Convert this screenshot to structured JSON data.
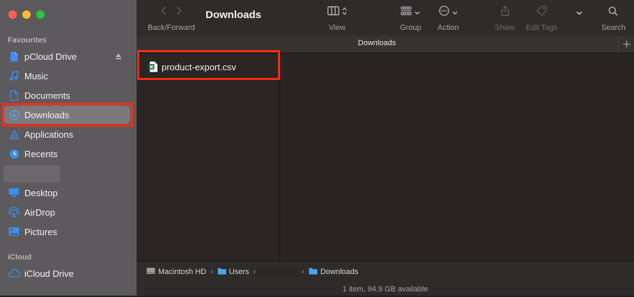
{
  "sidebar": {
    "favourites_label": "Favourites",
    "icloud_label": "iCloud",
    "items": [
      {
        "label": "pCloud Drive",
        "icon": "document-icon"
      },
      {
        "label": "Music",
        "icon": "music-note-icon"
      },
      {
        "label": "Documents",
        "icon": "document-icon"
      },
      {
        "label": "Downloads",
        "icon": "download-circle-icon"
      },
      {
        "label": "Applications",
        "icon": "applications-icon"
      },
      {
        "label": "Recents",
        "icon": "clock-icon"
      },
      {
        "label": "Desktop",
        "icon": "desktop-icon"
      },
      {
        "label": "AirDrop",
        "icon": "airdrop-icon"
      },
      {
        "label": "Pictures",
        "icon": "pictures-icon"
      },
      {
        "label": "iCloud Drive",
        "icon": "cloud-icon"
      }
    ],
    "selected": "Downloads"
  },
  "toolbar": {
    "title": "Downloads",
    "back_forward_label": "Back/Forward",
    "view_label": "View",
    "group_label": "Group",
    "action_label": "Action",
    "share_label": "Share",
    "edit_tags_label": "Edit Tags",
    "search_label": "Search"
  },
  "tab": {
    "label": "Downloads"
  },
  "files": [
    {
      "name": "product-export.csv",
      "icon": "csv-file-icon"
    }
  ],
  "pathbar": {
    "crumbs": [
      "Macintosh HD",
      "Users",
      "Downloads"
    ]
  },
  "status": {
    "text": "1 item, 94.9 GB available"
  },
  "colors": {
    "accent": "#3a8ef6",
    "highlight": "#ff2a12",
    "sidebar_bg": "#5d5a5d",
    "content_bg": "#2a2424"
  }
}
